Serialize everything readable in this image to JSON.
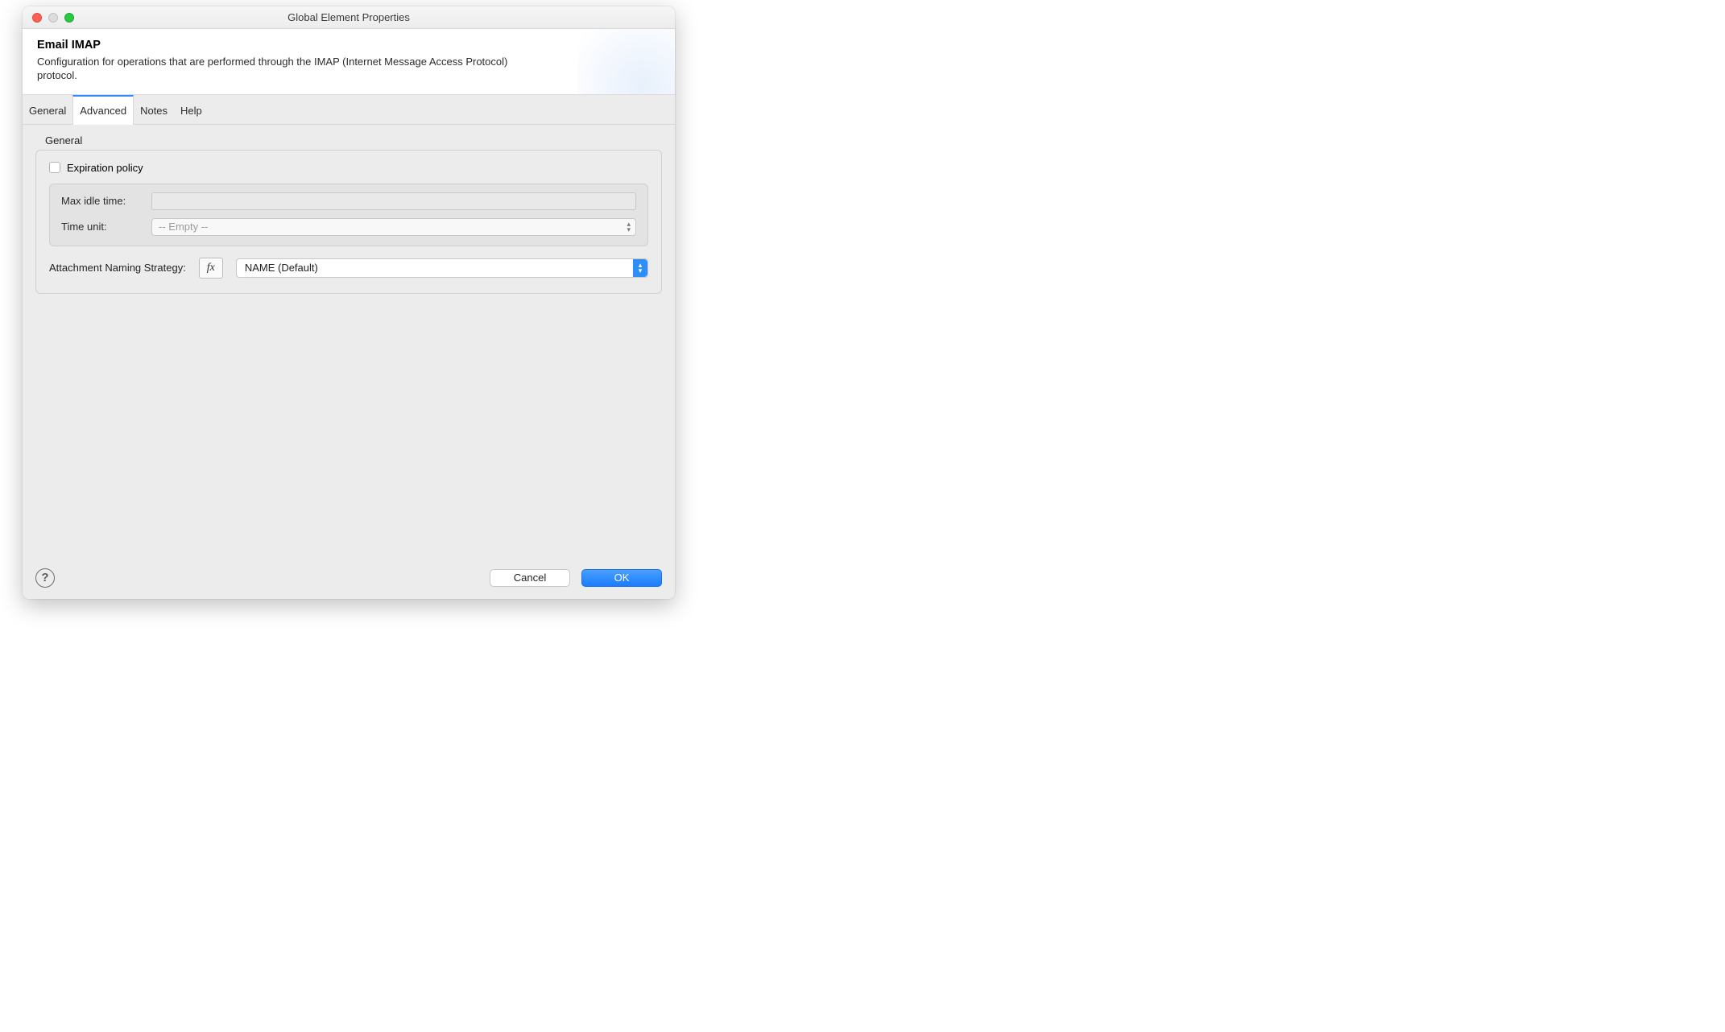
{
  "window": {
    "title": "Global Element Properties"
  },
  "header": {
    "title": "Email IMAP",
    "description": "Configuration for operations that are performed through the IMAP (Internet Message Access Protocol) protocol."
  },
  "tabs": [
    {
      "label": "General"
    },
    {
      "label": "Advanced"
    },
    {
      "label": "Notes"
    },
    {
      "label": "Help"
    }
  ],
  "section": {
    "label": "General"
  },
  "expiration": {
    "label": "Expiration policy",
    "max_idle_label": "Max idle time:",
    "max_idle_value": "",
    "time_unit_label": "Time unit:",
    "time_unit_value": "-- Empty --"
  },
  "strategy": {
    "label": "Attachment Naming Strategy:",
    "fx": "fx",
    "value": "NAME (Default)"
  },
  "footer": {
    "help": "?",
    "cancel": "Cancel",
    "ok": "OK"
  }
}
